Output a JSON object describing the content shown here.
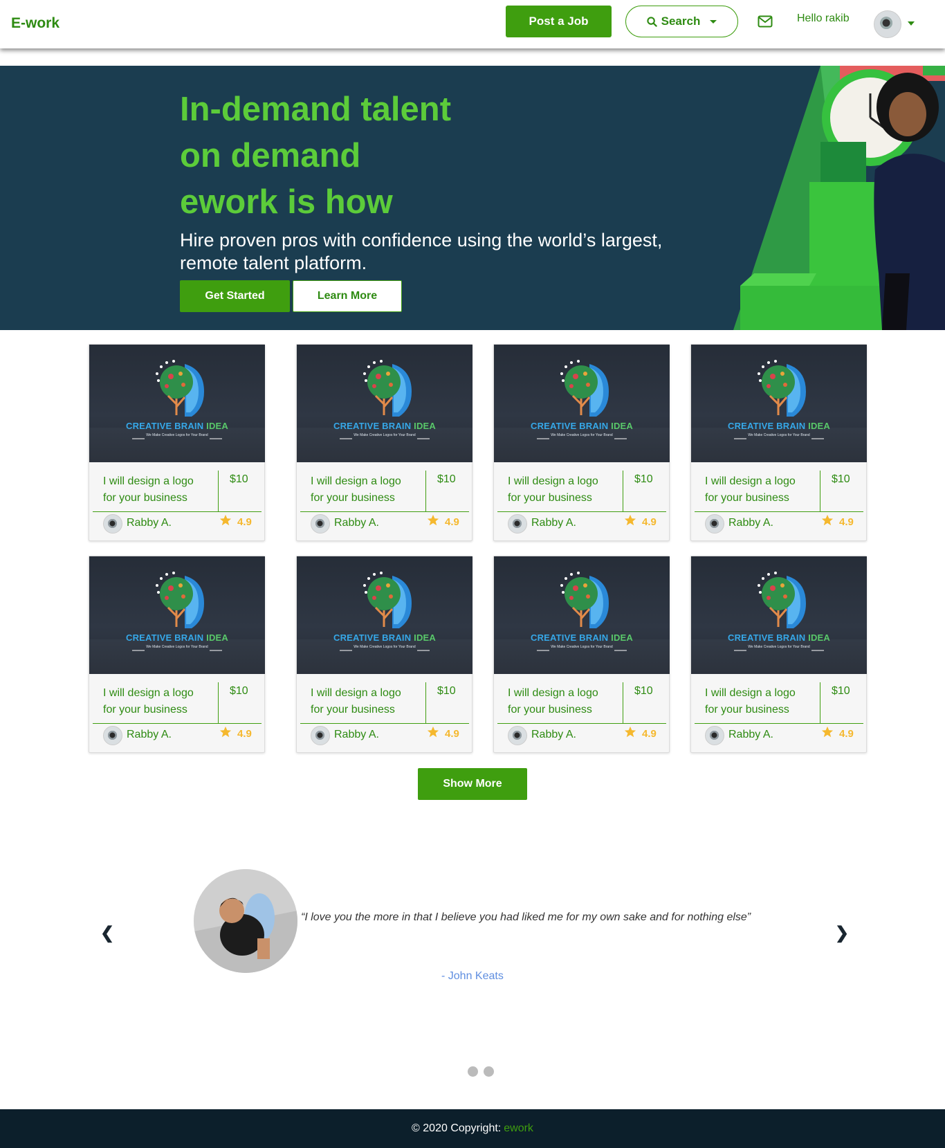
{
  "navbar": {
    "brand": "E-work",
    "post_job_label": "Post a Job",
    "search_label": "Search",
    "greeting": "Hello rakib"
  },
  "hero": {
    "title_line1": "In-demand talent",
    "title_line2": "on demand",
    "title_line3": "ework is how",
    "subtitle": "Hire proven pros with confidence using the world’s largest, remote talent platform.",
    "get_started_label": "Get Started",
    "learn_more_label": "Learn More"
  },
  "gigs": [
    {
      "logo_name_a": "CREATIVE BRAIN",
      "logo_name_b": "IDEA",
      "logo_tagline": "We Make Creative Logos for Your Brand",
      "title": "I will design a logo for your business",
      "price": "$10",
      "seller": "Rabby A.",
      "rating": "4.9"
    },
    {
      "logo_name_a": "CREATIVE BRAIN",
      "logo_name_b": "IDEA",
      "logo_tagline": "We Make Creative Logos for Your Brand",
      "title": "I will design a logo for your business",
      "price": "$10",
      "seller": "Rabby A.",
      "rating": "4.9"
    },
    {
      "logo_name_a": "CREATIVE BRAIN",
      "logo_name_b": "IDEA",
      "logo_tagline": "We Make Creative Logos for Your Brand",
      "title": "I will design a logo for your business",
      "price": "$10",
      "seller": "Rabby A.",
      "rating": "4.9"
    },
    {
      "logo_name_a": "CREATIVE BRAIN",
      "logo_name_b": "IDEA",
      "logo_tagline": "We Make Creative Logos for Your Brand",
      "title": "I will design a logo for your business",
      "price": "$10",
      "seller": "Rabby A.",
      "rating": "4.9"
    },
    {
      "logo_name_a": "CREATIVE BRAIN",
      "logo_name_b": "IDEA",
      "logo_tagline": "We Make Creative Logos for Your Brand",
      "title": "I will design a logo for your business",
      "price": "$10",
      "seller": "Rabby A.",
      "rating": "4.9"
    },
    {
      "logo_name_a": "CREATIVE BRAIN",
      "logo_name_b": "IDEA",
      "logo_tagline": "We Make Creative Logos for Your Brand",
      "title": "I will design a logo for your business",
      "price": "$10",
      "seller": "Rabby A.",
      "rating": "4.9"
    },
    {
      "logo_name_a": "CREATIVE BRAIN",
      "logo_name_b": "IDEA",
      "logo_tagline": "We Make Creative Logos for Your Brand",
      "title": "I will design a logo for your business",
      "price": "$10",
      "seller": "Rabby A.",
      "rating": "4.9"
    },
    {
      "logo_name_a": "CREATIVE BRAIN",
      "logo_name_b": "IDEA",
      "logo_tagline": "We Make Creative Logos for Your Brand",
      "title": "I will design a logo for your business",
      "price": "$10",
      "seller": "Rabby A.",
      "rating": "4.9"
    }
  ],
  "show_more_label": "Show More",
  "testimonial": {
    "prev_glyph": "❮",
    "next_glyph": "❯",
    "quote": "“I love you the more in that I believe you had liked me for my own sake and for nothing else”",
    "author": "- John Keats"
  },
  "footer": {
    "copyright": "© 2020 Copyright:",
    "link": "ework"
  },
  "colors": {
    "brand_green": "#3f9e0f",
    "text_green": "#2e8b12",
    "hero_bg": "#1b3d50",
    "hero_title": "#5ccc3a",
    "rating_gold": "#f5b82e",
    "footer_bg": "#0c1f2b"
  },
  "icons": [
    "search-icon",
    "mail-icon",
    "chevron-down-icon",
    "star-icon",
    "chevron-left-icon",
    "chevron-right-icon"
  ]
}
